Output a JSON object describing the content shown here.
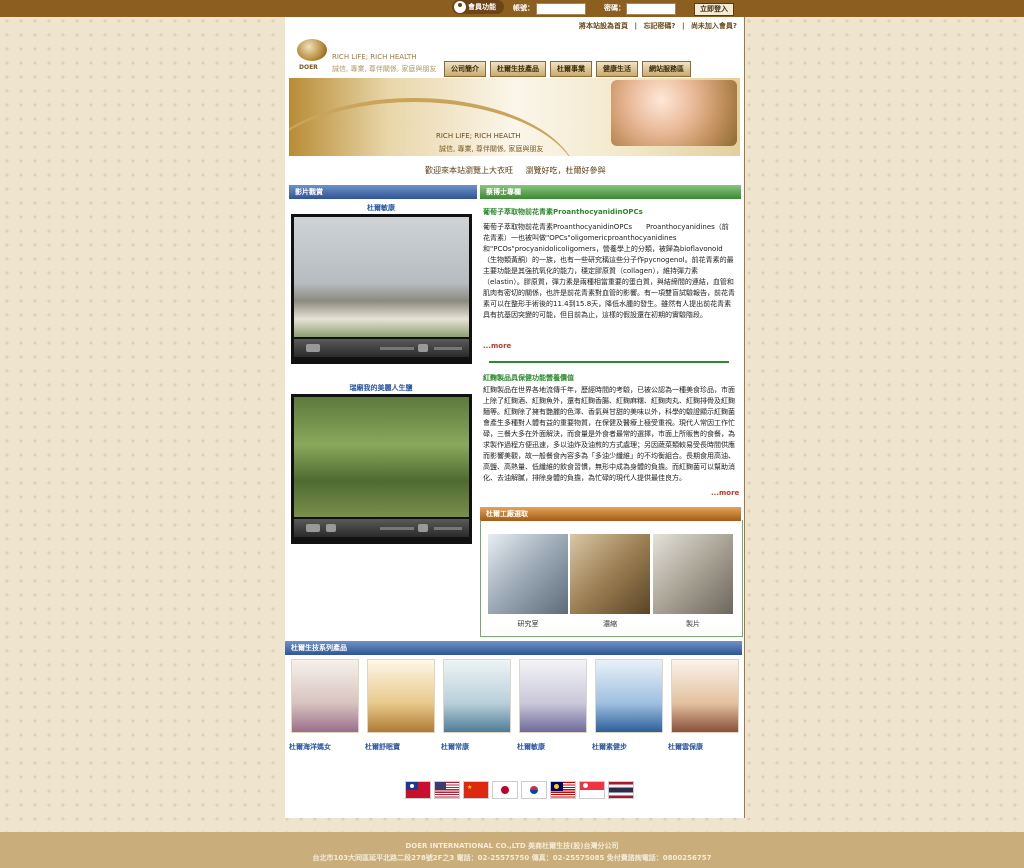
{
  "topbar": {
    "member_label": "會員功能",
    "account_label": "帳號：",
    "password_label": "密碼：",
    "login_button": "立即登入"
  },
  "toplinks": [
    "將本站設為首頁",
    "|",
    "忘記密碼?",
    "|",
    "尚未加入會員?"
  ],
  "logo": {
    "brand": "DOER",
    "tagline_en": "RICH LIFE; RICH HEALTH",
    "tagline_zh": "誠信, 專業, 尊伴關係, 家庭與朋友"
  },
  "nav": [
    "公司簡介",
    "杜爾生技產品",
    "杜爾事業",
    "健康生活",
    "網站服務區"
  ],
  "banner": {
    "line1": "RICH LIFE; RICH HEALTH",
    "line2": "誠信, 專業, 尊伴關係, 家庭與朋友"
  },
  "slogan": [
    "歡迎來本站瀏覽上大衣旺",
    "瀏覽好吃，杜爾好參與"
  ],
  "video_section": {
    "title": "影片觀賞",
    "videos": [
      {
        "title": "杜爾敏康"
      },
      {
        "title": "瑞廟我的美麗人生鹽"
      }
    ]
  },
  "doctor_section": {
    "title": "蔡博士專欄",
    "article1": {
      "title": "葡萄子萃取物前花青素ProanthocyanidinOPCs",
      "body": "葡萄子萃取物前花青素ProanthocyanidinOPCs　　Proanthocyanidines（前花青素）一也被叫做\"OPCs\"oligomericproanthocyanidines和\"PCOs\"procyanidolicoligomers，營養學上的分類，被歸為bioflavonoid（生物類黃酮）的一族，也有一些研究稱這些分子作pycnogenol。前花青素的最主要功能是其強抗氧化的能力，穩定膠原質（collagen），維持彈力素（elastin）。膠原質，彈力素是兩種相當重要的蛋白質，與結締間的連結，血管和肌肉有密切的關係，也許是前花青素對血管的影響。有一項雙盲試驗報告，前花青素可以在整形手術後的11.4到15.8天，降低水腫的發生。雖然有人提出前花青素具有抗基因突變的可能，但目前為止，這樣的假設還在初期的實驗階段。",
      "more": "...more"
    },
    "article2": {
      "title": "紅麴製品具保健功能營養價值",
      "body": "紅麴製品在世界各地流傳千年，歷經時間的考驗，已被公認為一種美食珍品，市面上除了紅麴酒、紅麴魚外，還有紅麴香腸、紅麴麻糬、紅麴肉丸、紅麴排骨及紅麴麵等。紅麴除了擁有艷麗的色澤、香氣與甘甜的美味以外，科學的驗證顯示紅麴菌會產生多種對人體有益的重要物質，在保健及醫療上極受重視。現代人常因工作忙碌，三餐大多在外面解決，而食量是外食者最常的選擇，市面上所販售的食餐，為求製作過程方便迅速，多以油炸及油煎的方式處理；另因蔬菜類較易受長時間供應而影響美觀，故一般餐食內容多為「多油少纖維」的不均衡組合。長期食用高油、高鹽、高熱量、低纖維的飲食習慣，無形中成為身體的負擔。而紅麴菌可以幫助消化、去油解膩，排除身體的負擔，為忙碌的現代人提供最佳良方。",
      "more": "...more"
    }
  },
  "factory_section": {
    "title": "杜爾工廠選取",
    "items": [
      {
        "label": "研究室"
      },
      {
        "label": "濃縮"
      },
      {
        "label": "製片"
      }
    ]
  },
  "products_section": {
    "title": "杜爾生技系列產品",
    "items": [
      {
        "label": "杜爾海洋媽女"
      },
      {
        "label": "杜爾舒眠寶"
      },
      {
        "label": "杜爾常康"
      },
      {
        "label": "杜爾敏康"
      },
      {
        "label": "杜爾素健步"
      },
      {
        "label": "杜爾雲保康"
      }
    ]
  },
  "languages": [
    "taiwan-flag-icon",
    "usa-flag-icon",
    "china-flag-icon",
    "japan-flag-icon",
    "korea-flag-icon",
    "malaysia-flag-icon",
    "singapore-flag-icon",
    "thailand-flag-icon"
  ],
  "footer": {
    "line1": "DOER INTERNATIONAL CO.,LTD 美商杜爾生技(股)台灣分公司",
    "line2": "台北市103大同區延平北路二段278號2F之3 電話：02-25575750 傳真：02-25575085 免付費諮詢電話：0800256757"
  }
}
